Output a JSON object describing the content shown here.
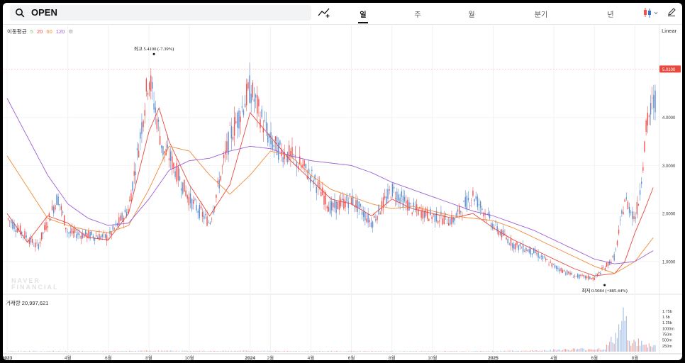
{
  "search": {
    "symbol": "OPEN"
  },
  "tabs": [
    {
      "label": "일",
      "active": true
    },
    {
      "label": "주",
      "active": false
    },
    {
      "label": "월",
      "active": false
    },
    {
      "label": "분기",
      "active": false
    },
    {
      "label": "년",
      "active": false
    }
  ],
  "icons": {
    "search": "search-icon",
    "indicator": "add-indicator-icon",
    "chart_style": "candlestick-icon",
    "draw": "pencil-icon"
  },
  "ma_legend": {
    "label": "이동평균",
    "periods": [
      "5",
      "20",
      "60",
      "120"
    ],
    "colors": [
      "#7bc96f",
      "#ef5350",
      "#f28c38",
      "#9c5fd6"
    ]
  },
  "scale_mode": "Linear",
  "colors": {
    "up": "#ef5350",
    "down": "#5b8fd6",
    "ma5": "#7bc96f",
    "ma20": "#e8493f",
    "ma60": "#f28c38",
    "ma120": "#9c5fd6",
    "price_tag": "#e8493f"
  },
  "watermark": [
    "NAVER",
    "FINANCIAL"
  ],
  "chart_data": [
    {
      "type": "line",
      "title": "OPEN",
      "price_axis": {
        "ticks": [
          "1.0000",
          "2.0000",
          "3.0000",
          "4.0000"
        ],
        "tick_values": [
          1,
          2,
          3,
          4
        ],
        "ylim": [
          0.48,
          5.65
        ]
      },
      "current_price": {
        "label": "5.0100",
        "value": 5.01
      },
      "high_annotation": {
        "label": "최고 5.4100 (-7.39%)",
        "value": 5.41,
        "date": "2023-08"
      },
      "low_annotation": {
        "label": "최저 0.5084 (+885.44%)",
        "value": 0.5084,
        "date": "2025-06"
      },
      "x_axis": {
        "labels": [
          "2023",
          "4월",
          "6월",
          "8월",
          "10월",
          "2024",
          "2월",
          "4월",
          "6월",
          "8월",
          "10월",
          "2025",
          "4월",
          "6월",
          "8월"
        ],
        "bold": [
          true,
          false,
          false,
          false,
          false,
          true,
          false,
          false,
          false,
          false,
          false,
          true,
          false,
          false,
          false
        ],
        "month_index": [
          0,
          3,
          5,
          7,
          9,
          12,
          13,
          15,
          17,
          19,
          21,
          24,
          27,
          29,
          31
        ],
        "months_span": 32
      },
      "series": [
        {
          "name": "5",
          "x_month": [
            0,
            1.5,
            2.5,
            3,
            4,
            5,
            6,
            6.5,
            7,
            7.3,
            7.7,
            8,
            9,
            10,
            11,
            12,
            13,
            13.5,
            14,
            15,
            16,
            17,
            18,
            19,
            20,
            21,
            22,
            23,
            24,
            25,
            26,
            27,
            28,
            29,
            30,
            30.5,
            31,
            31.2,
            31.6,
            32
          ],
          "y": [
            1.9,
            1.3,
            2.35,
            1.6,
            1.55,
            1.5,
            2.1,
            3.4,
            4.9,
            4.2,
            3.3,
            3.2,
            2.3,
            1.8,
            3.6,
            4.6,
            3.5,
            3.3,
            3.2,
            2.8,
            2.1,
            2.3,
            1.8,
            2.5,
            2.1,
            1.95,
            1.85,
            2.4,
            1.75,
            1.35,
            1.2,
            0.9,
            0.7,
            0.65,
            1.1,
            2.3,
            1.9,
            2.3,
            3.9,
            4.4
          ]
        },
        {
          "name": "20",
          "x_month": [
            0,
            1,
            2,
            3,
            4,
            5,
            6,
            7,
            7.5,
            8,
            9,
            10,
            11,
            12,
            13,
            14,
            15,
            16,
            17,
            18,
            19,
            20,
            21,
            22,
            23,
            24,
            25,
            26,
            27,
            28,
            29,
            30,
            30.5,
            31,
            31.5,
            32
          ],
          "y": [
            2.0,
            1.4,
            1.95,
            1.8,
            1.5,
            1.45,
            2.0,
            3.7,
            4.2,
            3.5,
            2.6,
            1.95,
            2.6,
            4.1,
            3.6,
            3.1,
            2.7,
            2.3,
            2.2,
            1.95,
            2.3,
            2.1,
            2.0,
            1.9,
            2.0,
            1.7,
            1.45,
            1.25,
            1.05,
            0.85,
            0.7,
            0.75,
            1.0,
            1.6,
            2.1,
            2.65
          ]
        },
        {
          "name": "60",
          "x_month": [
            0,
            2,
            3,
            4,
            5,
            6,
            7,
            8,
            9,
            10,
            11,
            12,
            13,
            14,
            15,
            16,
            17,
            18,
            19,
            20,
            21,
            22,
            23,
            24,
            25,
            26,
            27,
            28,
            29,
            30,
            31,
            32
          ],
          "y": [
            3.2,
            1.9,
            1.75,
            1.65,
            1.6,
            1.75,
            2.5,
            3.4,
            3.3,
            2.8,
            2.4,
            2.8,
            3.3,
            3.2,
            2.8,
            2.5,
            2.35,
            2.2,
            2.1,
            2.15,
            2.05,
            1.95,
            1.9,
            1.85,
            1.7,
            1.5,
            1.3,
            1.1,
            0.9,
            0.75,
            1.0,
            1.55
          ]
        },
        {
          "name": "120",
          "x_month": [
            0,
            1,
            2,
            3,
            4,
            5,
            6,
            7,
            8,
            9,
            10,
            11,
            12,
            13,
            14,
            15,
            16,
            17,
            18,
            19,
            20,
            21,
            22,
            23,
            24,
            25,
            26,
            27,
            28,
            29,
            30,
            31,
            32
          ],
          "y": [
            4.4,
            3.6,
            2.8,
            2.2,
            1.9,
            1.75,
            1.8,
            2.3,
            2.9,
            3.1,
            3.15,
            3.3,
            3.4,
            3.35,
            3.2,
            3.1,
            3.05,
            3.0,
            2.85,
            2.65,
            2.5,
            2.35,
            2.2,
            2.05,
            1.95,
            1.8,
            1.65,
            1.45,
            1.25,
            1.05,
            0.95,
            1.0,
            1.25
          ]
        }
      ]
    },
    {
      "type": "bar",
      "title": "거래량",
      "value_label": "20,997,621",
      "y_ticks": [
        "250m",
        "500m",
        "750m",
        "1000m",
        "1.25b",
        "1.5b",
        "1.75b"
      ],
      "tick_values": [
        250,
        500,
        750,
        1000,
        1250,
        1500,
        1750
      ],
      "ylim": [
        0,
        1900
      ],
      "x_month": [
        0,
        3,
        5,
        7,
        9,
        12,
        15,
        17,
        19,
        21,
        24,
        26,
        28,
        29.5,
        30,
        30.5,
        30.8,
        31.0,
        31.2,
        31.5,
        31.8,
        32
      ],
      "values": [
        30,
        25,
        20,
        45,
        35,
        40,
        25,
        30,
        20,
        25,
        30,
        50,
        120,
        140,
        700,
        1650,
        600,
        400,
        500,
        260,
        380,
        300
      ]
    }
  ]
}
